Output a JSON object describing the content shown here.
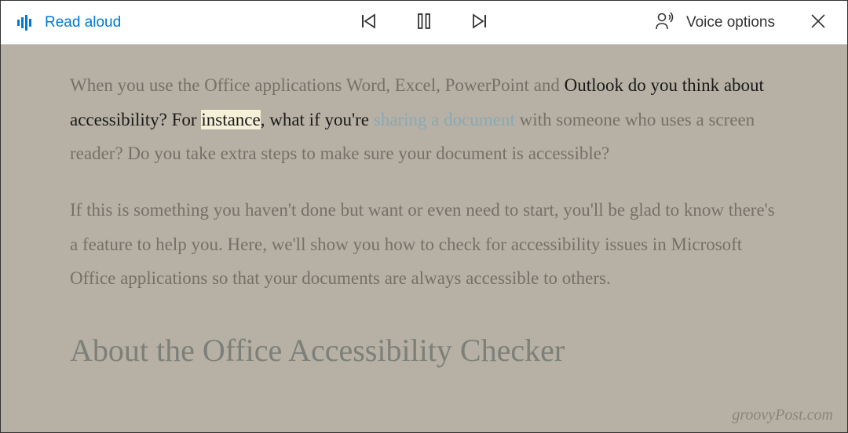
{
  "toolbar": {
    "read_aloud_label": "Read aloud",
    "voice_options_label": "Voice options"
  },
  "content": {
    "p1_before": "When you use the Office applications Word, Excel, PowerPoint and ",
    "p1_active_before": "Outlook do you think about accessibility? For ",
    "p1_highlighted": "instance",
    "p1_active_after": ", what if you're ",
    "p1_link": "sharing a document",
    "p1_after": " with someone who uses a screen reader? Do you take extra steps to make sure your document is accessible?",
    "p2": "If this is something you haven't done but want or even need to start, you'll be glad to know there's a feature to help you. Here, we'll show you how to check for accessibility issues in Microsoft Office applications so that your documents are always accessible to others.",
    "heading": "About the Office Accessibility Checker"
  },
  "watermark": "groovyPost.com"
}
